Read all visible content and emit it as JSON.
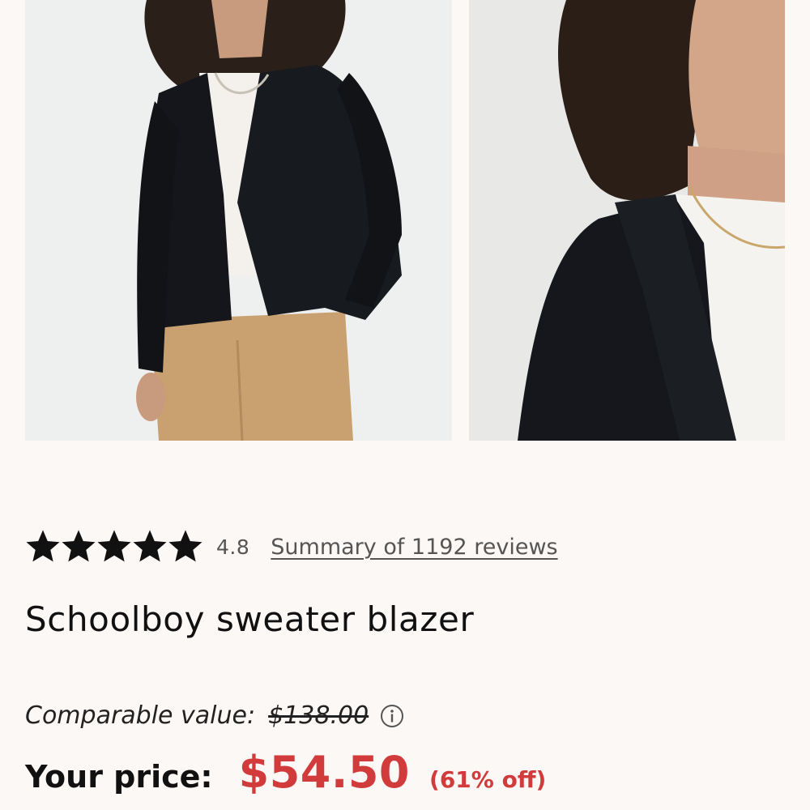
{
  "gallery": {
    "images": [
      {
        "alt": "model-front-view"
      },
      {
        "alt": "model-closeup-view"
      }
    ]
  },
  "product": {
    "rating": {
      "stars_filled": 5,
      "value": "4.8",
      "reviews_link": "Summary of 1192 reviews"
    },
    "title": "Schoolboy sweater blazer",
    "comparable": {
      "label": "Comparable value:",
      "value": "$138.00"
    },
    "price": {
      "label": "Your price:",
      "value": "$54.50",
      "discount": "(61% off)"
    }
  },
  "colors": {
    "background": "#fcf8f5",
    "sale_red": "#d23b3b",
    "text": "#111111",
    "muted_text": "#555555"
  },
  "icons": {
    "star": "star-icon",
    "info": "info-icon"
  }
}
